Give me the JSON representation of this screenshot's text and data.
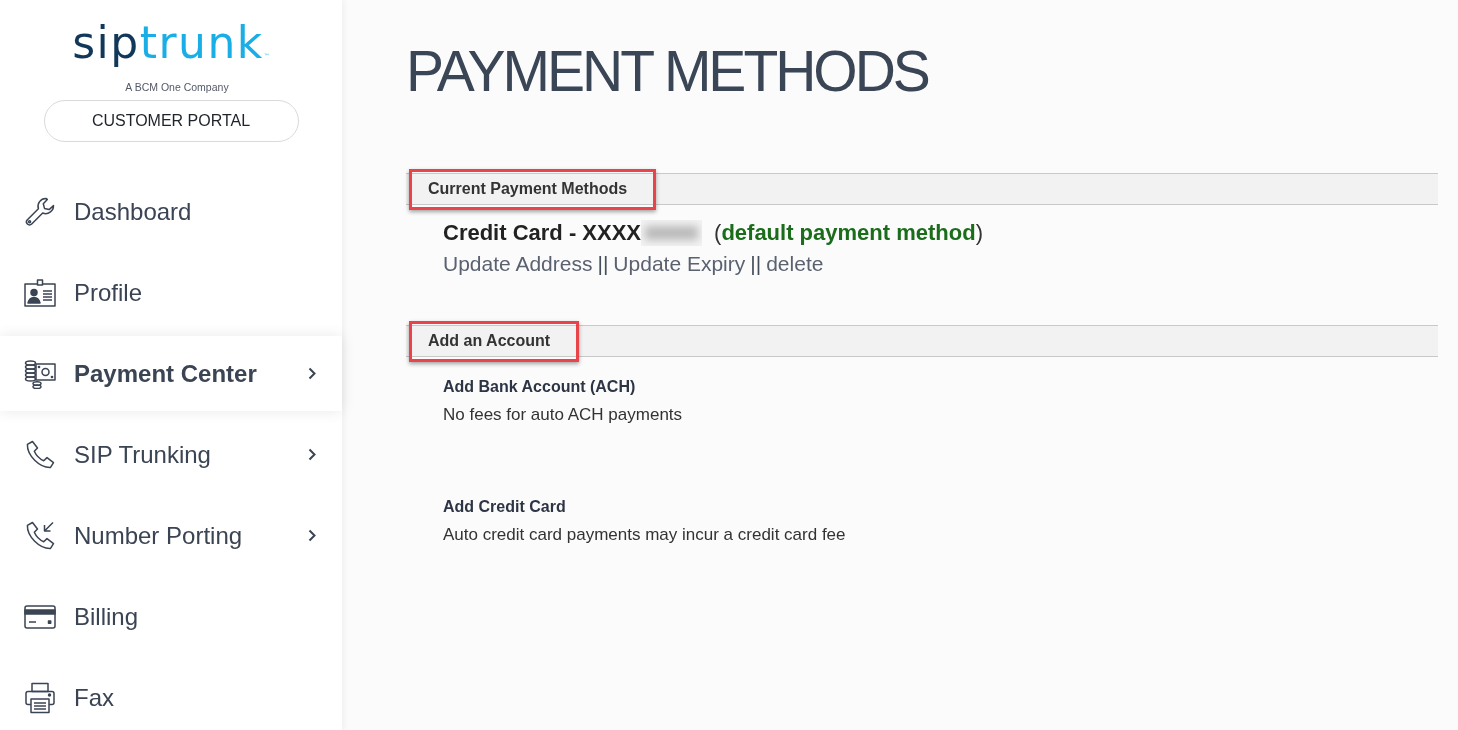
{
  "sidebar": {
    "logo": {
      "wordmark_part_1": "sip",
      "wordmark_part_2": "trunk",
      "trademark": "™",
      "tagline": "A BCM One Company"
    },
    "portal_label": "CUSTOMER PORTAL",
    "items": [
      {
        "kind": "dashboard",
        "label": "Dashboard",
        "selected": false,
        "has_submenu": false
      },
      {
        "kind": "profile",
        "label": "Profile",
        "selected": false,
        "has_submenu": false
      },
      {
        "kind": "payments",
        "label": "Payment Center",
        "selected": true,
        "has_submenu": true
      },
      {
        "kind": "trunking",
        "label": "SIP Trunking",
        "selected": false,
        "has_submenu": true
      },
      {
        "kind": "porting",
        "label": "Number Porting",
        "selected": false,
        "has_submenu": true
      },
      {
        "kind": "billing",
        "label": "Billing",
        "selected": false,
        "has_submenu": false
      },
      {
        "kind": "fax",
        "label": "Fax",
        "selected": false,
        "has_submenu": false
      }
    ]
  },
  "main": {
    "title": "PAYMENT METHODS",
    "sections": [
      {
        "kind": "current_methods",
        "title": "Current Payment Methods",
        "highlighted": true,
        "methods": [
          {
            "label": "Credit Card - XXXX",
            "number_redacted": true,
            "note": "(**default payment method**)",
            "actions": [
              {
                "kind": "link",
                "text": "Update Address"
              },
              {
                "kind": "separator",
                "text": "||"
              },
              {
                "kind": "link",
                "text": "Update Expiry"
              },
              {
                "kind": "separator",
                "text": "||"
              },
              {
                "kind": "link",
                "text": "delete"
              }
            ]
          }
        ]
      },
      {
        "kind": "add_account",
        "title": "Add an Account",
        "highlighted": true,
        "options": [
          {
            "title": "Add Bank Account (ACH)",
            "description": "No fees for auto ACH payments"
          },
          {
            "title": "Add Credit Card",
            "description": "Auto credit card payments may incur a credit card fee"
          }
        ]
      }
    ]
  }
}
